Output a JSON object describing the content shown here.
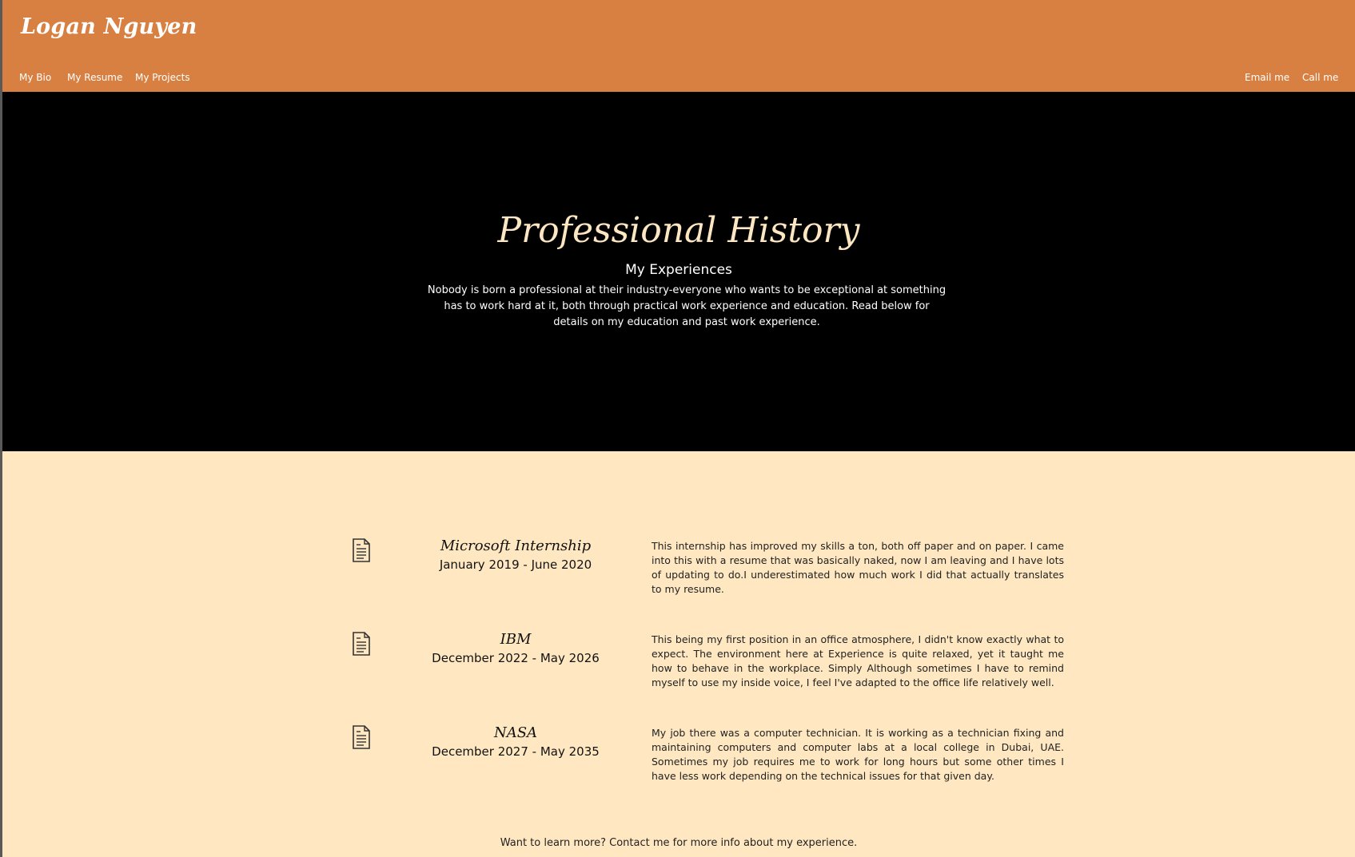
{
  "header": {
    "site_title": "Logan Nguyen",
    "nav_left": [
      "My Bio",
      "My Resume",
      "My Projects"
    ],
    "nav_right": [
      "Email me",
      "Call me"
    ]
  },
  "hero": {
    "title": "Professional History",
    "subtitle": "My Experiences",
    "text": "Nobody is born a professional at their industry-everyone who wants to be exceptional at something has to work hard at it, both through practical work experience and education. Read below for details on my education and past work experience."
  },
  "experiences": [
    {
      "icon": "document-icon",
      "company": "Microsoft Internship",
      "dates": "January 2019 - June 2020",
      "description": "This internship has improved my skills a ton, both off paper and on paper. I came into this with a resume that was basically naked, now I am leaving and I have lots of updating to do.I underestimated how much work I did that actually translates to my resume."
    },
    {
      "icon": "document-icon",
      "company": "IBM",
      "dates": "December 2022 - May 2026",
      "description": "This being my first position in an office atmosphere, I didn't know exactly what to expect. The environment here at Experience is quite relaxed, yet it taught me how to behave in the workplace. Simply Although sometimes I have to remind myself to use my inside voice, I feel I've adapted to the office life relatively well."
    },
    {
      "icon": "document-icon",
      "company": "NASA",
      "dates": "December 2027 - May 2035",
      "description": "My job there was a computer technician. It is working as a technician fixing and maintaining computers and computer labs at a local college in Dubai, UAE. Sometimes my job requires me to work for long hours but some other times I have less work depending on the technical issues for that given day."
    }
  ],
  "footer": {
    "note": "Want to learn more? Contact me for more info about my experience."
  },
  "colors": {
    "header_bg": "#d88041",
    "hero_bg": "#000000",
    "hero_title": "#fde6c2",
    "content_bg": "#ffe8c1"
  }
}
